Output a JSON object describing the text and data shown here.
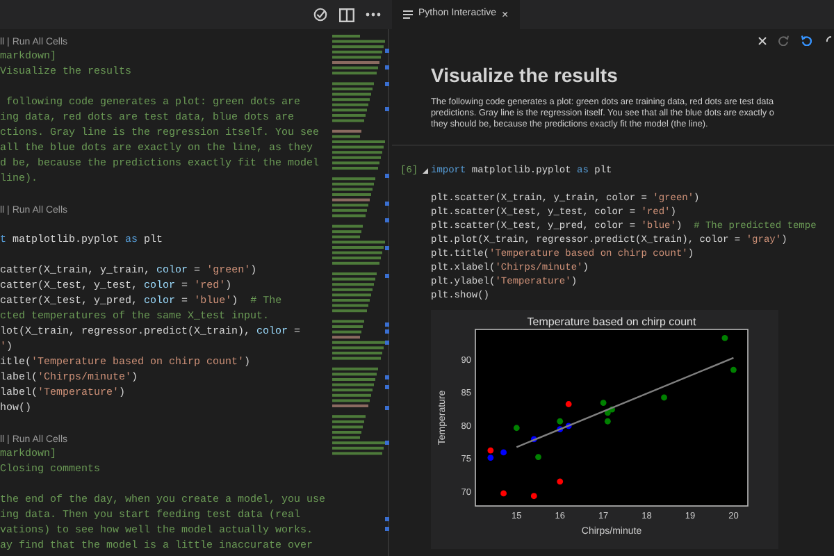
{
  "editor": {
    "blocks": [
      [
        {
          "kind": "codelens",
          "text": "ll | Run All Cells"
        },
        {
          "kind": "code",
          "segments": [
            {
              "kind": "comment",
              "text": "markdown]"
            }
          ]
        },
        {
          "kind": "code",
          "segments": [
            {
              "kind": "comment",
              "text": "Visualize the results"
            }
          ]
        }
      ],
      [
        {
          "kind": "code",
          "segments": [
            {
              "kind": "comment",
              "text": " following code generates a plot: green dots are"
            }
          ]
        },
        {
          "kind": "code",
          "segments": [
            {
              "kind": "comment",
              "text": "ing data, red dots are test data, blue dots are"
            }
          ]
        },
        {
          "kind": "code",
          "segments": [
            {
              "kind": "comment",
              "text": "ctions. Gray line is the regression itself. You see"
            }
          ]
        },
        {
          "kind": "code",
          "segments": [
            {
              "kind": "comment",
              "text": "all the blue dots are exactly on the line, as they"
            }
          ]
        },
        {
          "kind": "code",
          "segments": [
            {
              "kind": "comment",
              "text": "d be, because the predictions exactly fit the model"
            }
          ]
        },
        {
          "kind": "code",
          "segments": [
            {
              "kind": "comment",
              "text": "line)."
            }
          ]
        }
      ],
      [
        {
          "kind": "codelens",
          "text": "ll | Run All Cells"
        }
      ],
      [
        {
          "kind": "code",
          "segments": [
            {
              "kind": "keyword",
              "text": "t"
            },
            {
              "kind": "plain",
              "text": " matplotlib.pyplot "
            },
            {
              "kind": "keyword",
              "text": "as"
            },
            {
              "kind": "plain",
              "text": " plt"
            }
          ]
        }
      ],
      [
        {
          "kind": "code",
          "segments": [
            {
              "kind": "plain",
              "text": "catter(X_train, y_train, "
            },
            {
              "kind": "param",
              "text": "color"
            },
            {
              "kind": "plain",
              "text": " = "
            },
            {
              "kind": "string",
              "text": "'green'"
            },
            {
              "kind": "plain",
              "text": ")"
            }
          ]
        },
        {
          "kind": "code",
          "segments": [
            {
              "kind": "plain",
              "text": "catter(X_test, y_test, "
            },
            {
              "kind": "param",
              "text": "color"
            },
            {
              "kind": "plain",
              "text": " = "
            },
            {
              "kind": "string",
              "text": "'red'"
            },
            {
              "kind": "plain",
              "text": ")"
            }
          ]
        },
        {
          "kind": "code",
          "segments": [
            {
              "kind": "plain",
              "text": "catter(X_test, y_pred, "
            },
            {
              "kind": "param",
              "text": "color"
            },
            {
              "kind": "plain",
              "text": " = "
            },
            {
              "kind": "string",
              "text": "'blue'"
            },
            {
              "kind": "plain",
              "text": ")  "
            },
            {
              "kind": "comment",
              "text": "# The"
            }
          ]
        },
        {
          "kind": "code",
          "segments": [
            {
              "kind": "comment",
              "text": "cted temperatures of the same X_test input."
            }
          ]
        },
        {
          "kind": "code",
          "segments": [
            {
              "kind": "plain",
              "text": "lot(X_train, regressor.predict(X_train), "
            },
            {
              "kind": "param",
              "text": "color"
            },
            {
              "kind": "plain",
              "text": " ="
            }
          ]
        },
        {
          "kind": "code",
          "segments": [
            {
              "kind": "string",
              "text": "'"
            },
            {
              "kind": "plain",
              "text": ")"
            }
          ]
        },
        {
          "kind": "code",
          "segments": [
            {
              "kind": "plain",
              "text": "itle("
            },
            {
              "kind": "string",
              "text": "'Temperature based on chirp count'"
            },
            {
              "kind": "plain",
              "text": ")"
            }
          ]
        },
        {
          "kind": "code",
          "segments": [
            {
              "kind": "plain",
              "text": "label("
            },
            {
              "kind": "string",
              "text": "'Chirps/minute'"
            },
            {
              "kind": "plain",
              "text": ")"
            }
          ]
        },
        {
          "kind": "code",
          "segments": [
            {
              "kind": "plain",
              "text": "label("
            },
            {
              "kind": "string",
              "text": "'Temperature'"
            },
            {
              "kind": "plain",
              "text": ")"
            }
          ]
        },
        {
          "kind": "code",
          "segments": [
            {
              "kind": "plain",
              "text": "how()"
            }
          ]
        }
      ],
      [
        {
          "kind": "codelens",
          "text": "ll | Run All Cells"
        },
        {
          "kind": "code",
          "segments": [
            {
              "kind": "comment",
              "text": "markdown]"
            }
          ]
        },
        {
          "kind": "code",
          "segments": [
            {
              "kind": "comment",
              "text": "Closing comments"
            }
          ]
        }
      ],
      [
        {
          "kind": "code",
          "segments": [
            {
              "kind": "comment",
              "text": "the end of the day, when you create a model, you use"
            }
          ]
        },
        {
          "kind": "code",
          "segments": [
            {
              "kind": "comment",
              "text": "ing data. Then you start feeding test data (real"
            }
          ]
        },
        {
          "kind": "code",
          "segments": [
            {
              "kind": "comment",
              "text": "vations) to see how well the model actually works."
            }
          ]
        },
        {
          "kind": "code",
          "segments": [
            {
              "kind": "comment",
              "text": "ay find that the model is a little inaccurate over"
            }
          ]
        }
      ]
    ]
  },
  "interactive": {
    "tab": {
      "label": "Python Interactive",
      "close": "×"
    },
    "heading": "Visualize the results",
    "paragraph_lines": [
      "The following code generates a plot: green dots are training data, red dots are test data",
      "predictions. Gray line is the regression itself. You see that all the blue dots are exactly o",
      "they should be, because the predictions exactly fit the model (the line)."
    ],
    "cell": {
      "execution_count": "[6]",
      "expanded": true,
      "blocks": [
        [
          [
            {
              "kind": "keyword",
              "text": "import"
            },
            {
              "kind": "plain",
              "text": " matplotlib.pyplot "
            },
            {
              "kind": "keyword",
              "text": "as"
            },
            {
              "kind": "plain",
              "text": " plt"
            }
          ]
        ],
        [
          [
            {
              "kind": "plain",
              "text": "plt.scatter(X_train, y_train, color = "
            },
            {
              "kind": "string",
              "text": "'green'"
            },
            {
              "kind": "plain",
              "text": ")"
            }
          ],
          [
            {
              "kind": "plain",
              "text": "plt.scatter(X_test, y_test, color = "
            },
            {
              "kind": "string",
              "text": "'red'"
            },
            {
              "kind": "plain",
              "text": ")"
            }
          ],
          [
            {
              "kind": "plain",
              "text": "plt.scatter(X_test, y_pred, color = "
            },
            {
              "kind": "string",
              "text": "'blue'"
            },
            {
              "kind": "plain",
              "text": ")  "
            },
            {
              "kind": "comment",
              "text": "# The predicted tempe"
            }
          ],
          [
            {
              "kind": "plain",
              "text": "plt.plot(X_train, regressor.predict(X_train), color = "
            },
            {
              "kind": "string",
              "text": "'gray'"
            },
            {
              "kind": "plain",
              "text": ")"
            }
          ],
          [
            {
              "kind": "plain",
              "text": "plt.title("
            },
            {
              "kind": "string",
              "text": "'Temperature based on chirp count'"
            },
            {
              "kind": "plain",
              "text": ")"
            }
          ],
          [
            {
              "kind": "plain",
              "text": "plt.xlabel("
            },
            {
              "kind": "string",
              "text": "'Chirps/minute'"
            },
            {
              "kind": "plain",
              "text": ")"
            }
          ],
          [
            {
              "kind": "plain",
              "text": "plt.ylabel("
            },
            {
              "kind": "string",
              "text": "'Temperature'"
            },
            {
              "kind": "plain",
              "text": ")"
            }
          ],
          [
            {
              "kind": "plain",
              "text": "plt.show()"
            }
          ]
        ]
      ],
      "chart_data": {
        "type": "scatter",
        "title": "Temperature based on chirp count",
        "xlabel": "Chirps/minute",
        "ylabel": "Temperature",
        "xlim": [
          14.05,
          20.33
        ],
        "ylim": [
          67.9,
          94.6
        ],
        "xticks": [
          15,
          16,
          17,
          18,
          19,
          20
        ],
        "yticks": [
          70,
          75,
          80,
          85,
          90
        ],
        "series": [
          {
            "type": "scatter",
            "color": "#008000",
            "x": [
              15,
              15.5,
              16,
              17,
              17.1,
              17.1,
              17.2,
              18.4,
              19.8,
              20
            ],
            "values": [
              79.7,
              75.3,
              80.7,
              83.5,
              82,
              80.7,
              82.5,
              84.3,
              93.3,
              88.5
            ]
          },
          {
            "type": "scatter",
            "color": "#ff0000",
            "x": [
              14.4,
              14.7,
              15.4,
              16,
              16.2
            ],
            "values": [
              76.3,
              69.8,
              69.4,
              71.6,
              83.3
            ]
          },
          {
            "type": "scatter",
            "color": "#0000ff",
            "x": [
              14.4,
              14.7,
              15.4,
              16,
              16.2
            ],
            "values": [
              75.2,
              76,
              78,
              79.5,
              80
            ]
          },
          {
            "type": "line",
            "color": "#808080",
            "x": [
              15,
              20
            ],
            "values": [
              76.8,
              90.3
            ]
          }
        ]
      }
    }
  }
}
